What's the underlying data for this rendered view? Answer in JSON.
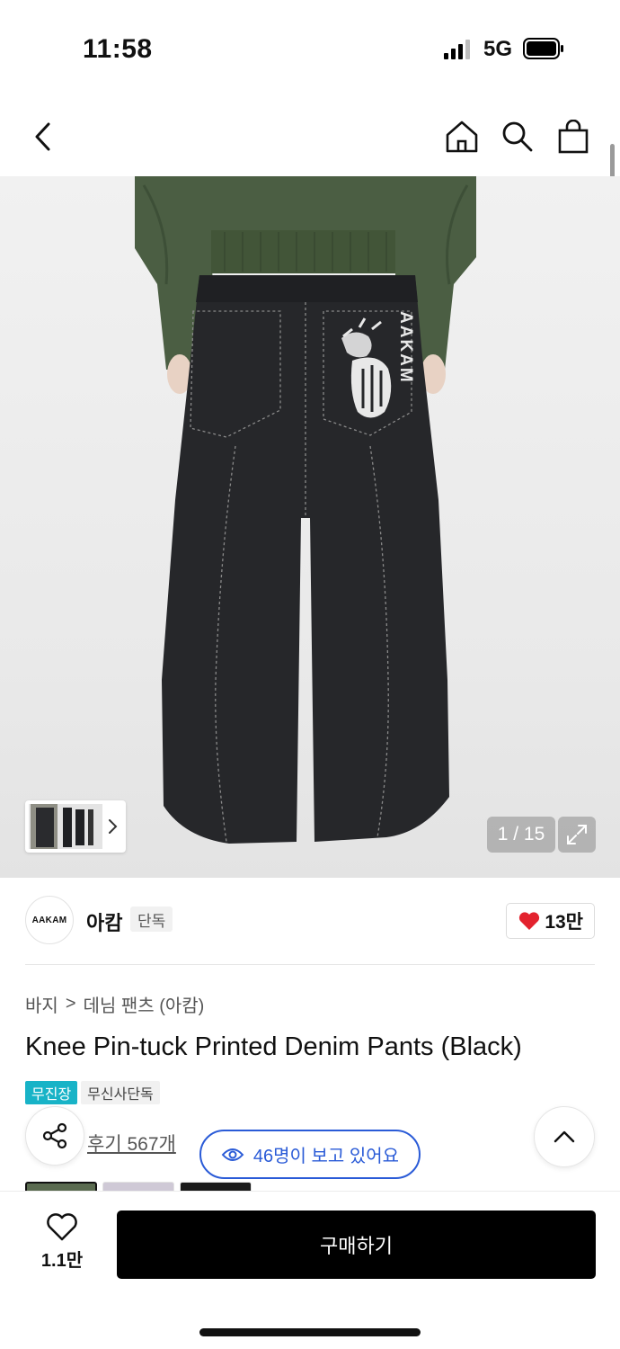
{
  "status_bar": {
    "time": "11:58",
    "network": "5G"
  },
  "nav": {
    "icons": [
      "back-icon",
      "home-icon",
      "search-icon",
      "shopping-bag-icon"
    ]
  },
  "gallery": {
    "counter": "1 / 15"
  },
  "brand": {
    "logo_text": "AAKAM",
    "name": "아캄",
    "tag": "단독",
    "likes": "13만"
  },
  "breadcrumb": {
    "level1": "바지",
    "separator": ">",
    "level2": "데님 팬츠 (아캄)"
  },
  "product": {
    "title": "Knee Pin-tuck Printed Denim Pants (Black)",
    "badges": [
      "무진장",
      "무신사단독"
    ],
    "print_text": "AAKAM"
  },
  "actions": {
    "review_link": "후기 567개",
    "viewers": "46명이 보고 있어요"
  },
  "bottom_bar": {
    "wish_count": "1.1만",
    "buy_label": "구매하기"
  },
  "colors": {
    "badge_primary": "#18b3c7",
    "viewer_accent": "#2a5bd7",
    "heart": "#e3222e",
    "jacket": "#4b5e43",
    "denim": "#26272a"
  }
}
